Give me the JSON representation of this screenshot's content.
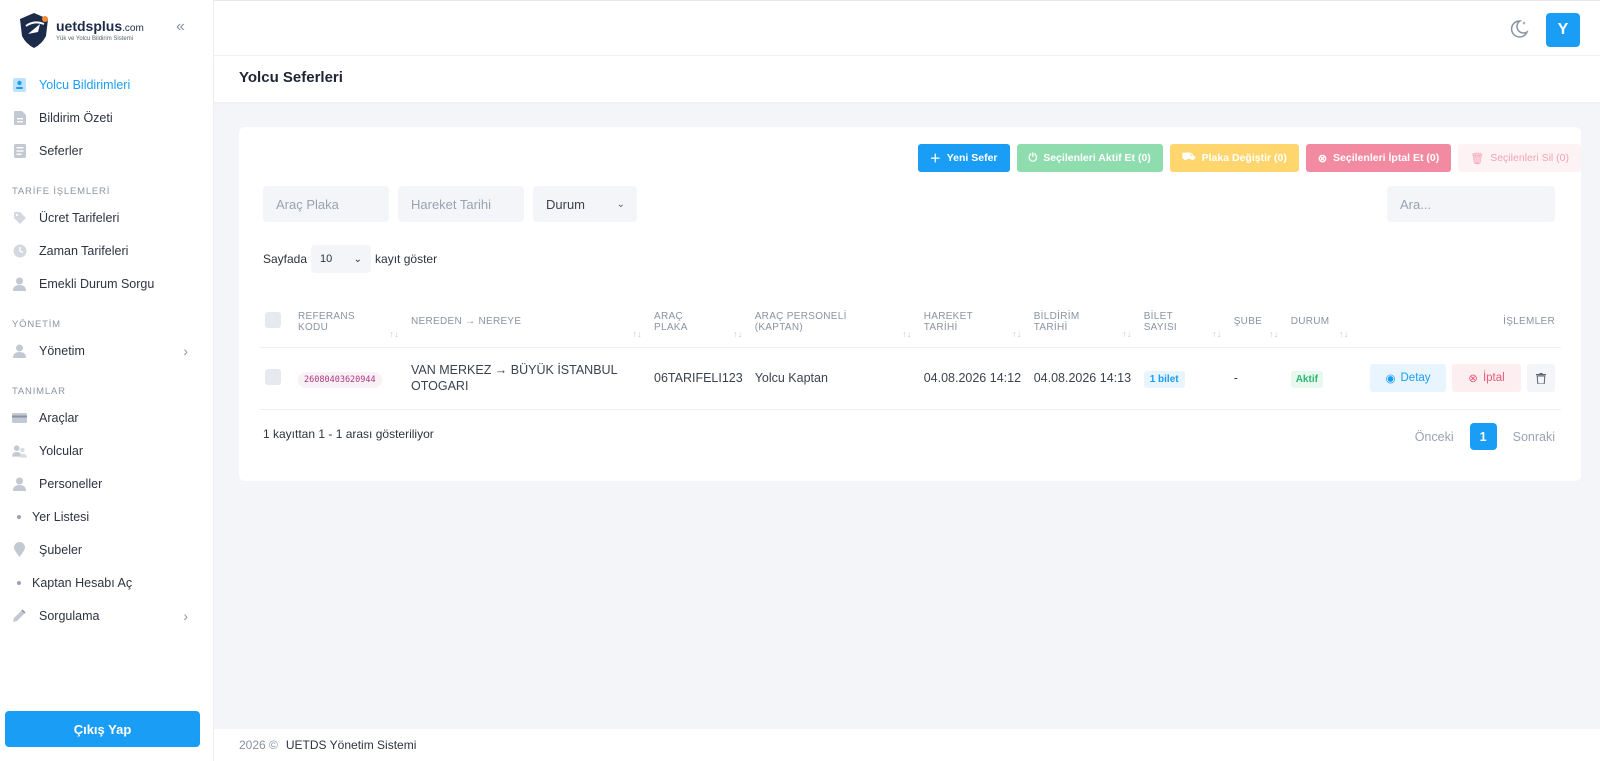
{
  "brand": {
    "name": "uetdsplus",
    "suffix": ".com",
    "tagline": "Yük ve Yolcu Bildirim Sistemi"
  },
  "sidebar": {
    "items_top": [
      {
        "label": "Yolcu Bildirimleri",
        "icon": "passenger-card-icon",
        "active": true
      },
      {
        "label": "Bildirim Özeti",
        "icon": "document-icon"
      },
      {
        "label": "Seferler",
        "icon": "list-icon"
      }
    ],
    "section_tarife": "TARİFE İŞLEMLERİ",
    "items_tarife": [
      {
        "label": "Ücret Tarifeleri",
        "icon": "tag-icon"
      },
      {
        "label": "Zaman Tarifeleri",
        "icon": "clock-icon"
      },
      {
        "label": "Emekli Durum Sorgu",
        "icon": "user-icon"
      }
    ],
    "section_yonetim": "YÖNETİM",
    "items_yonetim": [
      {
        "label": "Yönetim",
        "icon": "user-icon",
        "has_submenu": true
      }
    ],
    "section_tanimlar": "TANIMLAR",
    "items_tanimlar": [
      {
        "label": "Araçlar",
        "icon": "card-icon"
      },
      {
        "label": "Yolcular",
        "icon": "users-icon"
      },
      {
        "label": "Personeller",
        "icon": "user-icon"
      },
      {
        "label": "Yer Listesi",
        "icon": "dot-icon"
      },
      {
        "label": "Şubeler",
        "icon": "map-pin-icon"
      },
      {
        "label": "Kaptan Hesabı Aç",
        "icon": "dot-icon"
      },
      {
        "label": "Sorgulama",
        "icon": "pen-icon",
        "has_submenu": true
      }
    ],
    "logout_label": "Çıkış Yap"
  },
  "topbar": {
    "avatar_letter": "Y"
  },
  "page": {
    "title": "Yolcu Seferleri"
  },
  "toolbar": {
    "new_label": "Yeni Sefer",
    "activate_label": "Seçilenleri Aktif Et (0)",
    "plate_label": "Plaka Değiştir (0)",
    "cancel_label": "Seçilenleri İptal Et (0)",
    "delete_label": "Seçilenleri Sil (0)",
    "colors": {
      "new": "#1a9df5",
      "activate": "#8fdcae",
      "plate": "#ffd66e",
      "cancel": "#f28ba1",
      "delete_bg": "#fdf3f5",
      "delete_text": "#f4a3b5"
    }
  },
  "filters": {
    "plate_placeholder": "Araç Plaka",
    "date_placeholder": "Hareket Tarihi",
    "status_value": "Durum",
    "search_placeholder": "Ara..."
  },
  "length": {
    "prefix": "Sayfada",
    "value": "10",
    "suffix": "kayıt göster"
  },
  "table": {
    "headers": {
      "ref": [
        "REFERANS",
        "KODU"
      ],
      "route": "NEREDEN → NEREYE",
      "plate": [
        "ARAÇ",
        "PLAKA"
      ],
      "staff": [
        "ARAÇ PERSONELİ",
        "(KAPTAN)"
      ],
      "departure": [
        "HAREKET",
        "TARİHİ"
      ],
      "notify": [
        "BİLDİRİM",
        "TARİHİ"
      ],
      "tickets": [
        "BİLET",
        "SAYISI"
      ],
      "branch": "ŞUBE",
      "status": "DURUM",
      "actions": "İŞLEMLER"
    },
    "rows": [
      {
        "ref": "26080403620944",
        "route_line1": "VAN MERKEZ → BÜYÜK İSTANBUL",
        "route_line2": "OTOGARI",
        "plate": "06TARIFELI123",
        "staff": "Yolcu Kaptan",
        "departure": "04.08.2026 14:12",
        "notify": "04.08.2026 14:13",
        "tickets": "1 bilet",
        "branch": "-",
        "status": "Aktif",
        "detail_label": "Detay",
        "cancel_label": "İptal"
      }
    ]
  },
  "info": "1 kayıttan 1 - 1 arası gösteriliyor",
  "pager": {
    "prev": "Önceki",
    "current": "1",
    "next": "Sonraki"
  },
  "footer": {
    "year": "2026 ©",
    "name": "UETDS Yönetim Sistemi"
  }
}
